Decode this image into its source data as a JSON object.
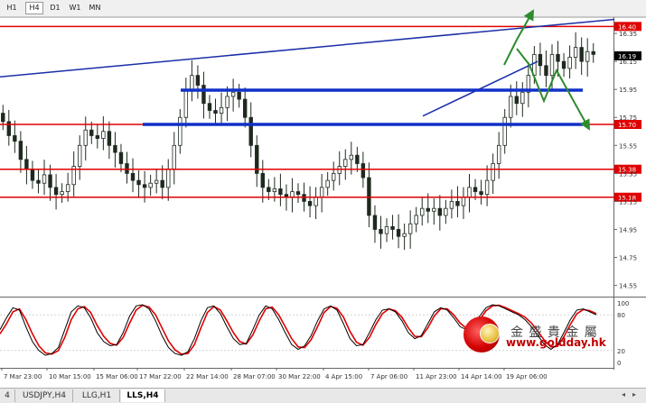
{
  "toolbar": {
    "timeframes": [
      {
        "label": "H1",
        "selected": false
      },
      {
        "label": "H4",
        "selected": true
      },
      {
        "label": "D1",
        "selected": false
      },
      {
        "label": "W1",
        "selected": false
      },
      {
        "label": "MN",
        "selected": false
      }
    ]
  },
  "colors": {
    "candle": "#1f2a1f",
    "support_resistance": "#e00000",
    "trend_line": "#1a2ea8",
    "zone_line": "#1030c8",
    "arrow": "#2e8b2e",
    "stoch_main": "#000000",
    "stoch_signal": "#e00000"
  },
  "chart_data": {
    "type": "candlestick",
    "price_axis_ticks": [
      "16.35",
      "16.15",
      "15.95",
      "15.75",
      "15.55",
      "15.35",
      "15.15",
      "14.95",
      "14.75",
      "14.55"
    ],
    "price_axis_range": [
      14.47,
      16.46
    ],
    "current_price": "16.19",
    "horizontal_levels": [
      "16.40",
      "15.70",
      "15.38",
      "15.18"
    ],
    "blue_zone_levels": [
      15.945,
      15.7
    ],
    "time_axis_labels": [
      "7 Mar 23:00",
      "10 Mar 15:00",
      "15 Mar 06:00",
      "17 Mar 22:00",
      "22 Mar 14:00",
      "28 Mar 07:00",
      "30 Mar 22:00",
      "4 Apr 15:00",
      "7 Apr 06:00",
      "11 Apr 23:00",
      "14 Apr 14:00",
      "19 Apr 06:00"
    ],
    "closes": [
      15.72,
      15.62,
      15.58,
      15.45,
      15.38,
      15.3,
      15.28,
      15.34,
      15.25,
      15.2,
      15.22,
      15.27,
      15.4,
      15.55,
      15.66,
      15.62,
      15.6,
      15.65,
      15.55,
      15.5,
      15.42,
      15.35,
      15.3,
      15.27,
      15.25,
      15.28,
      15.3,
      15.25,
      15.38,
      15.55,
      15.75,
      15.95,
      16.05,
      15.98,
      15.85,
      15.8,
      15.78,
      15.82,
      15.9,
      15.93,
      15.88,
      15.75,
      15.55,
      15.35,
      15.25,
      15.22,
      15.24,
      15.2,
      15.18,
      15.22,
      15.2,
      15.15,
      15.12,
      15.18,
      15.25,
      15.3,
      15.35,
      15.4,
      15.45,
      15.48,
      15.42,
      15.32,
      15.05,
      14.95,
      14.92,
      14.97,
      14.95,
      14.9,
      14.92,
      14.99,
      15.05,
      15.1,
      15.08,
      15.1,
      15.05,
      15.1,
      15.15,
      15.12,
      15.18,
      15.25,
      15.22,
      15.2,
      15.3,
      15.42,
      15.55,
      15.75,
      15.9,
      15.85,
      15.93,
      16.05,
      16.2,
      16.12,
      16.05,
      16.2,
      16.15,
      16.1,
      16.18,
      16.25,
      16.15,
      16.22,
      16.2
    ],
    "stochastic": {
      "levels": [
        "100",
        "80",
        "20",
        "0"
      ],
      "main": [
        55,
        75,
        92,
        88,
        60,
        35,
        20,
        12,
        15,
        25,
        55,
        85,
        95,
        92,
        75,
        50,
        35,
        28,
        30,
        50,
        78,
        95,
        97,
        90,
        70,
        45,
        25,
        15,
        12,
        18,
        40,
        70,
        92,
        95,
        82,
        60,
        40,
        30,
        32,
        55,
        80,
        95,
        90,
        72,
        50,
        30,
        22,
        28,
        45,
        70,
        90,
        95,
        88,
        65,
        40,
        28,
        30,
        50,
        72,
        88,
        90,
        85,
        70,
        50,
        40,
        45,
        65,
        85,
        92,
        88,
        75,
        60,
        55,
        62,
        78,
        92,
        97,
        95,
        90,
        85,
        80,
        72,
        60,
        45,
        30,
        22,
        30,
        50,
        72,
        88,
        90,
        85,
        80
      ],
      "signal": [
        48,
        65,
        85,
        90,
        72,
        48,
        28,
        16,
        14,
        20,
        42,
        72,
        90,
        94,
        84,
        62,
        44,
        32,
        29,
        42,
        66,
        88,
        96,
        93,
        80,
        58,
        36,
        21,
        14,
        15,
        30,
        58,
        84,
        94,
        88,
        70,
        50,
        35,
        31,
        46,
        70,
        90,
        93,
        80,
        60,
        40,
        26,
        25,
        38,
        60,
        84,
        94,
        91,
        76,
        52,
        34,
        29,
        42,
        64,
        82,
        90,
        87,
        76,
        58,
        44,
        43,
        58,
        78,
        90,
        90,
        80,
        66,
        57,
        59,
        72,
        87,
        95,
        96,
        92,
        87,
        82,
        76,
        66,
        52,
        37,
        26,
        27,
        43,
        64,
        82,
        89,
        87,
        82
      ]
    }
  },
  "logo": {
    "brand_cn": "金 盛 貴 金 屬",
    "url": "www.goldday.hk"
  },
  "bottom_tabs": [
    {
      "label": "4",
      "active": false
    },
    {
      "label": "USDJPY,H4",
      "active": false
    },
    {
      "label": "LLG,H1",
      "active": false
    },
    {
      "label": "LLS,H4",
      "active": true
    }
  ]
}
